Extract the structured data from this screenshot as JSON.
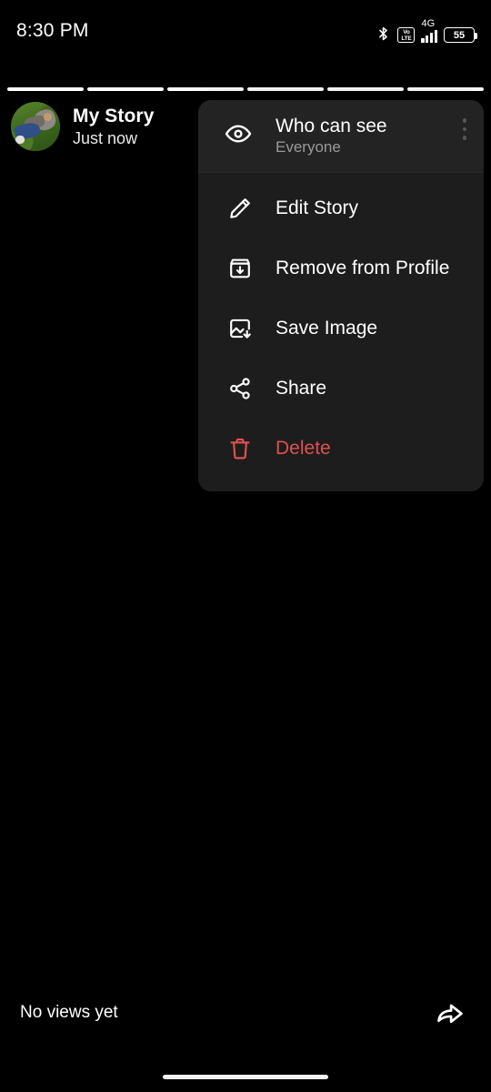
{
  "status_bar": {
    "clock": "8:30 PM",
    "bluetooth_icon": "bluetooth-icon",
    "volte_top": "Vo",
    "volte_bottom": "LTE",
    "network_generation": "4G",
    "signal_icon": "signal-bars-icon",
    "battery_level": "55"
  },
  "story": {
    "segment_count": 6,
    "active_segment": 6,
    "title": "My Story",
    "timestamp": "Just now",
    "avatar_name": "avatar",
    "views": "No views yet",
    "forward_icon": "forward-arrow-icon",
    "overflow_icon": "overflow-menu-icon",
    "visibility_chevron_icon": "chevron-down-icon"
  },
  "context_menu": {
    "visibility": {
      "icon": "eye-icon",
      "title": "Who can see",
      "subtitle": "Everyone"
    },
    "items": [
      {
        "icon": "pencil-icon",
        "label": "Edit Story",
        "danger": false
      },
      {
        "icon": "archive-down-icon",
        "label": "Remove from Profile",
        "danger": false
      },
      {
        "icon": "image-save-icon",
        "label": "Save Image",
        "danger": false
      },
      {
        "icon": "share-nodes-icon",
        "label": "Share",
        "danger": false
      },
      {
        "icon": "trash-icon",
        "label": "Delete",
        "danger": true
      }
    ]
  },
  "colors": {
    "background": "#000000",
    "menu_surface": "#1d1d1d",
    "menu_header_surface": "#232323",
    "text_primary": "#ffffff",
    "text_secondary": "#9a9a9a",
    "danger": "#e0504f",
    "pill": "#232b33"
  }
}
